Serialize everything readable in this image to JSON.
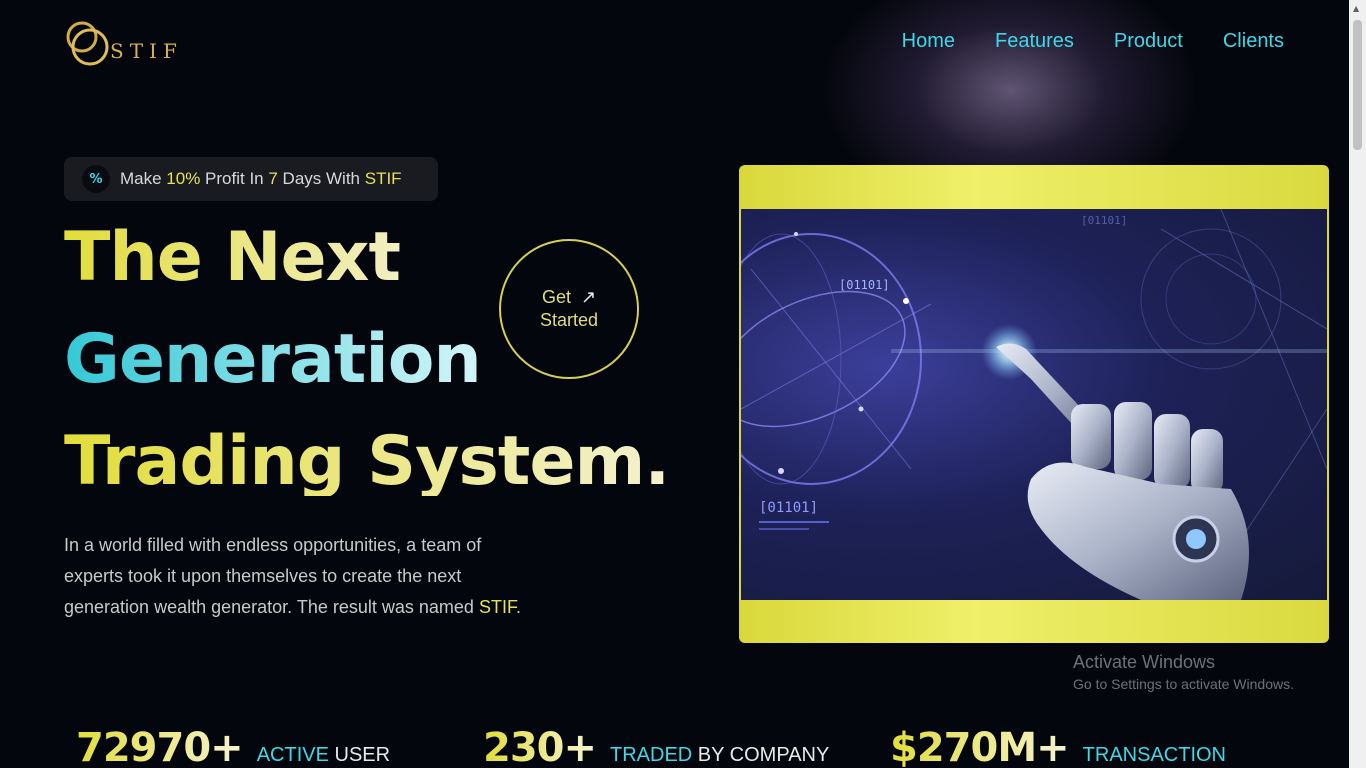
{
  "brand": {
    "logo_text": "STIF"
  },
  "nav": {
    "items": [
      "Home",
      "Features",
      "Product",
      "Clients"
    ]
  },
  "promo": {
    "icon": "percent-icon",
    "pre": "Make ",
    "profit": "10%",
    "mid": " Profit In ",
    "days": "7",
    "mid2": " Days With ",
    "brand": "STIF"
  },
  "hero": {
    "line1": "The Next",
    "line2": "Generation",
    "line3": "Trading System.",
    "cta_line1": "Get",
    "cta_line2": "Started",
    "cta_icon": "arrow-up-right-icon",
    "description_pre": "In a world filled with endless opportunities, a team of experts took it upon themselves to create the next generation wealth generator. The result was named ",
    "description_brand": "STIF",
    "description_post": "."
  },
  "image": {
    "code_label_1": "[01101]",
    "code_label_2": "[01101]",
    "code_label_3": "[01101]"
  },
  "watermark": {
    "title": "Activate Windows",
    "subtitle": "Go to Settings to activate Windows."
  },
  "stats": [
    {
      "value": "72970+",
      "label_a": "ACTIVE",
      "label_b": " USER"
    },
    {
      "value": "230+",
      "label_a": "TRADED",
      "label_b": " BY COMPANY"
    },
    {
      "value": "$270M+",
      "label_a": "TRANSACTION",
      "label_b": ""
    }
  ],
  "colors": {
    "accent_yellow": "#e2dd3a",
    "accent_cyan": "#3ed8e6",
    "background": "#04060d"
  }
}
